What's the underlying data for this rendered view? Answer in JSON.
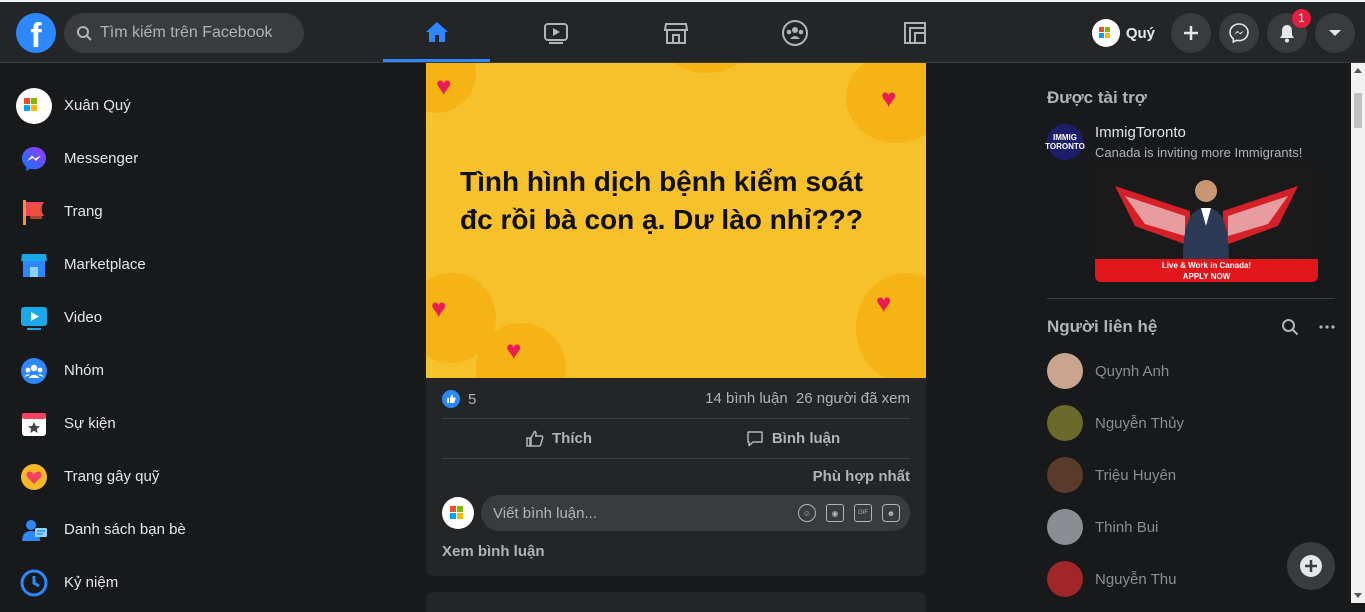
{
  "topbar": {
    "logo": "f",
    "search_placeholder": "Tìm kiếm trên Facebook",
    "tabs": [
      {
        "name": "home-icon"
      },
      {
        "name": "video-icon"
      },
      {
        "name": "marketplace-icon"
      },
      {
        "name": "groups-icon"
      },
      {
        "name": "gaming-icon"
      }
    ],
    "profile_name": "Quý",
    "notification_count": "1"
  },
  "sidebar": {
    "items": [
      {
        "label": "Xuân Quý",
        "icon": "avatar"
      },
      {
        "label": "Messenger",
        "icon": "messenger-icon"
      },
      {
        "label": "Trang",
        "icon": "flag-icon"
      },
      {
        "label": "Marketplace",
        "icon": "marketplace-icon"
      },
      {
        "label": "Video",
        "icon": "video-icon"
      },
      {
        "label": "Nhóm",
        "icon": "groups-icon"
      },
      {
        "label": "Sự kiện",
        "icon": "calendar-icon"
      },
      {
        "label": "Trang gây quỹ",
        "icon": "heart-icon"
      },
      {
        "label": "Danh sách bạn bè",
        "icon": "friends-icon"
      },
      {
        "label": "Kỷ niệm",
        "icon": "clock-icon"
      }
    ]
  },
  "post": {
    "image_text": "Tình hình dịch bệnh kiểm soát đc rồi bà con ạ. Dư lào nhỉ???",
    "likes": "5",
    "comments": "14 bình luận",
    "views": "26 người đã xem",
    "like_label": "Thích",
    "comment_label": "Bình luận",
    "sort_label": "Phù hợp nhất",
    "comment_placeholder": "Viết bình luận...",
    "view_comments": "Xem bình luận"
  },
  "right": {
    "sponsored_title": "Được tài trợ",
    "ad": {
      "name": "ImmigToronto",
      "description": "Canada is inviting more Immigrants!",
      "logo_text": "IMMIG TORONTO",
      "banner_line1": "Live & Work in Canada!",
      "banner_line2": "APPLY NOW"
    },
    "contacts_title": "Người liên hệ",
    "contacts": [
      {
        "name": "Quynh Anh",
        "color": "#c9a58f"
      },
      {
        "name": "Nguyễn Thủy",
        "color": "#6b6a2a"
      },
      {
        "name": "Triệu Huyên",
        "color": "#5a3a2a"
      },
      {
        "name": "Thinh Bui",
        "color": "#8a8d91"
      },
      {
        "name": "Nguyễn Thu",
        "color": "#a0262a"
      }
    ]
  },
  "colors": {
    "accent": "#2d88ff",
    "background": "#18191a",
    "surface": "#242526",
    "badge": "#e41e3f"
  }
}
